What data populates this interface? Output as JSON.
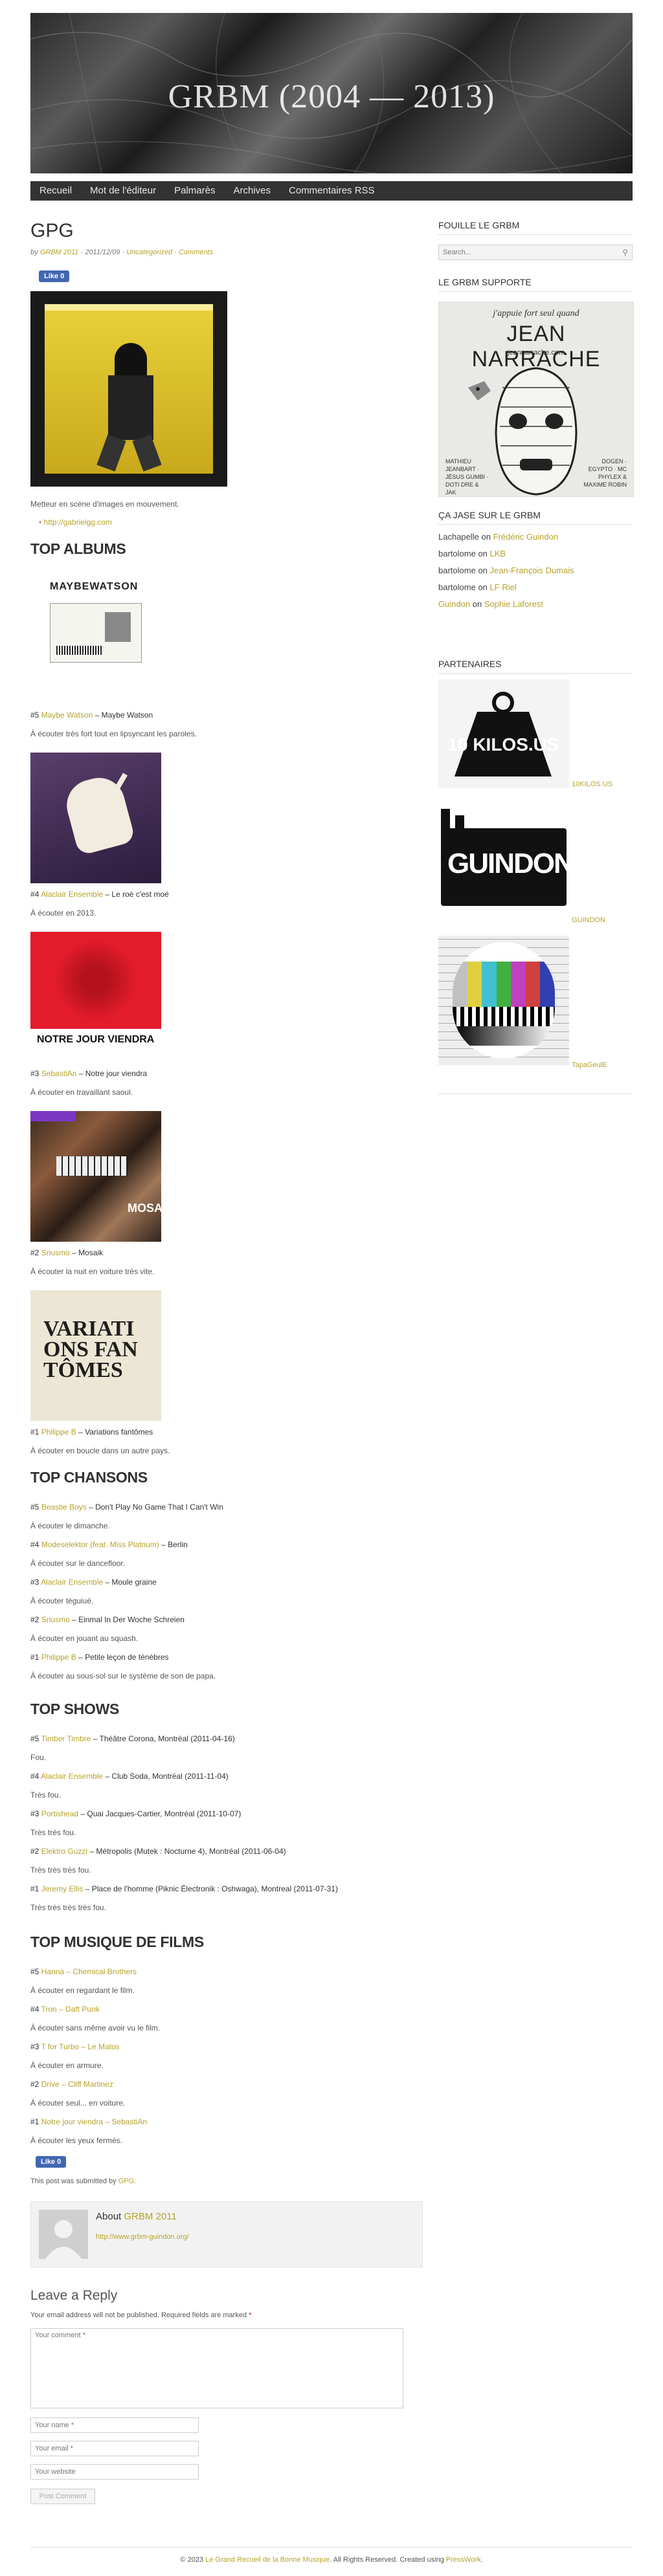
{
  "site": {
    "title": "GRBM (2004 — 2013)",
    "nav": [
      "Recueil",
      "Mot de l'éditeur",
      "Palmarès",
      "Archives",
      "Commentaires RSS"
    ]
  },
  "post": {
    "title": "GPG",
    "meta_by": "by",
    "author": "GRBM 2011",
    "date": "2011/12/09",
    "category": "Uncategorized",
    "comments": "Comments",
    "like": "Like 0",
    "intro": "Metteur en scène d'images en mouvement.",
    "link": "http://gabrielgg.com"
  },
  "top_albums": {
    "heading": "TOP ALBUMS",
    "items": [
      {
        "rank": "#5",
        "artist": "Maybe Watson",
        "title": "Maybe Watson",
        "desc": "À écouter très fort tout en lipsyncant les paroles.",
        "cover_text": "MAYBEWATSON"
      },
      {
        "rank": "#4",
        "artist": "Alaclair Ensemble",
        "title": "Le roé c'est moé",
        "desc": "À écouter en 2013.",
        "cover_text": ""
      },
      {
        "rank": "#3",
        "artist": "SebastiAn",
        "title": "Notre jour viendra",
        "desc": "À écouter en travaillant saoul.",
        "cover_text": "NOTRE JOUR VIENDRA"
      },
      {
        "rank": "#2",
        "artist": "Sriusmo",
        "title": "Mosaik",
        "desc": "À écouter la nuit en voiture très vite.",
        "cover_text": "MOSAIK"
      },
      {
        "rank": "#1",
        "artist": "Philippe B",
        "title": "Variations fantômes",
        "desc": "À écouter en boucle dans un autre pays.",
        "cover_text": "VARIATIONS FANTÔMES"
      }
    ]
  },
  "top_songs": {
    "heading": "TOP CHANSONS",
    "items": [
      {
        "rank": "#5",
        "artist": "Beastie Boys",
        "title": "Don't Play No Game That I Can't Win",
        "desc": "À écouter le dimanche."
      },
      {
        "rank": "#4",
        "artist": "Modeselektor (feat. Miss Platnum)",
        "title": "Berlin",
        "desc": "À écouter sur le dancefloor."
      },
      {
        "rank": "#3",
        "artist": "Alaclair Ensemble",
        "title": "Moule graine",
        "desc": "À écouter tèguiué."
      },
      {
        "rank": "#2",
        "artist": "Sriusmo",
        "title": "Einmal In Der Woche Schreien",
        "desc": "À écouter en jouant au squash."
      },
      {
        "rank": "#1",
        "artist": "Philippe B",
        "title": "Petite leçon de ténèbres",
        "desc": "À écouter au sous-sol sur le système de son de papa."
      }
    ]
  },
  "top_shows": {
    "heading": "TOP SHOWS",
    "items": [
      {
        "rank": "#5",
        "artist": "Timber Timbre",
        "title": "Théâtre Corona, Montréal (2011-04-16)",
        "desc": "Fou."
      },
      {
        "rank": "#4",
        "artist": "Alaclair Ensemble",
        "title": "Club Soda, Montréal (2011-11-04)",
        "desc": "Très fou."
      },
      {
        "rank": "#3",
        "artist": "Portishead",
        "title": "Quai Jacques-Cartier, Montréal (2011-10-07)",
        "desc": "Très très fou."
      },
      {
        "rank": "#2",
        "artist": "Elektro Guzzi",
        "title": "Métropolis (Mutek : Nocturne 4), Montréal (2011-06-04)",
        "desc": "Très très très fou."
      },
      {
        "rank": "#1",
        "artist": "Jeremy Ellis",
        "title": "Place de l'homme (Piknic Électronik : Oshwaga), Montreal (2011-07-31)",
        "desc": "Très très très très fou."
      }
    ]
  },
  "top_films": {
    "heading": "TOP MUSIQUE DE FILMS",
    "items": [
      {
        "rank": "#5",
        "artist": "Hanna – Chemical Brothers",
        "desc": "À écouter en regardant le film."
      },
      {
        "rank": "#4",
        "artist": "Tron – Daft Punk",
        "desc": "À écouter sans même avoir vu le film."
      },
      {
        "rank": "#3",
        "artist": "T for Turbo – Le Matos",
        "desc": "À écouter en armure."
      },
      {
        "rank": "#2",
        "artist": "Drive – Cliff Martinez",
        "desc": "À écouter seul... en voiture."
      },
      {
        "rank": "#1",
        "artist": "Notre jour viendra – SebastiAn",
        "desc": "À écouter les yeux fermés."
      }
    ]
  },
  "post_footer": {
    "like": "Like 0",
    "submitted_prefix": "This post was submitted by",
    "submitted_by": "GPG."
  },
  "about": {
    "label": "About",
    "name": "GRBM 2011",
    "url": "http://www.grbm-guindon.org/"
  },
  "reply": {
    "heading": "Leave a Reply",
    "note": "Your email address will not be published. Required fields are marked",
    "required_mark": "*",
    "comment_placeholder": "Your comment *",
    "name_placeholder": "Your name *",
    "email_placeholder": "Your email *",
    "website_placeholder": "Your website",
    "submit": "Post Comment"
  },
  "sidebar": {
    "search_heading": "FOUILLE LE GRBM",
    "search_placeholder": "Search...",
    "support_heading": "LE GRBM SUPPORTE",
    "poster": {
      "top_line": "j'appuie fort seul quand",
      "name": "JEAN NARRACHE",
      "url": "jeannarrache.com",
      "left_credits": "MATHIEU JEANBART · JÉSUS GUMBI · DOTI DRE & JAK",
      "right_credits": "DOGEN · EGYPTO · MC PHYLEX & MAXIME ROBIN"
    },
    "jase_heading": "ÇA JASE SUR LE GRBM",
    "jase": [
      {
        "who": "Lachapelle",
        "on": "on",
        "what": "Frédéric Guindon"
      },
      {
        "who": "bartolome",
        "on": "on",
        "what": "LKB"
      },
      {
        "who": "bartolome",
        "on": "on",
        "what": "Jean-François Dumais"
      },
      {
        "who": "bartolome",
        "on": "on",
        "what": "LF Riel"
      },
      {
        "who": "Guindon",
        "on": "on",
        "what": "Sophie Laforest"
      }
    ],
    "partners_heading": "PARTENAIRES",
    "partners": [
      {
        "name": "10KILOS.US",
        "logo_text": "10 KILOS.US"
      },
      {
        "name": "GUINDON",
        "logo_text": "GUINDON"
      },
      {
        "name": "TapaGeulE",
        "logo_text": ""
      }
    ]
  },
  "footer": {
    "year": "© 2023",
    "site": "Le Grand Recueil de la Bonne Musique",
    "rights": ". All Rights Reserved. Created using",
    "engine": "PressWork",
    "end": "."
  }
}
